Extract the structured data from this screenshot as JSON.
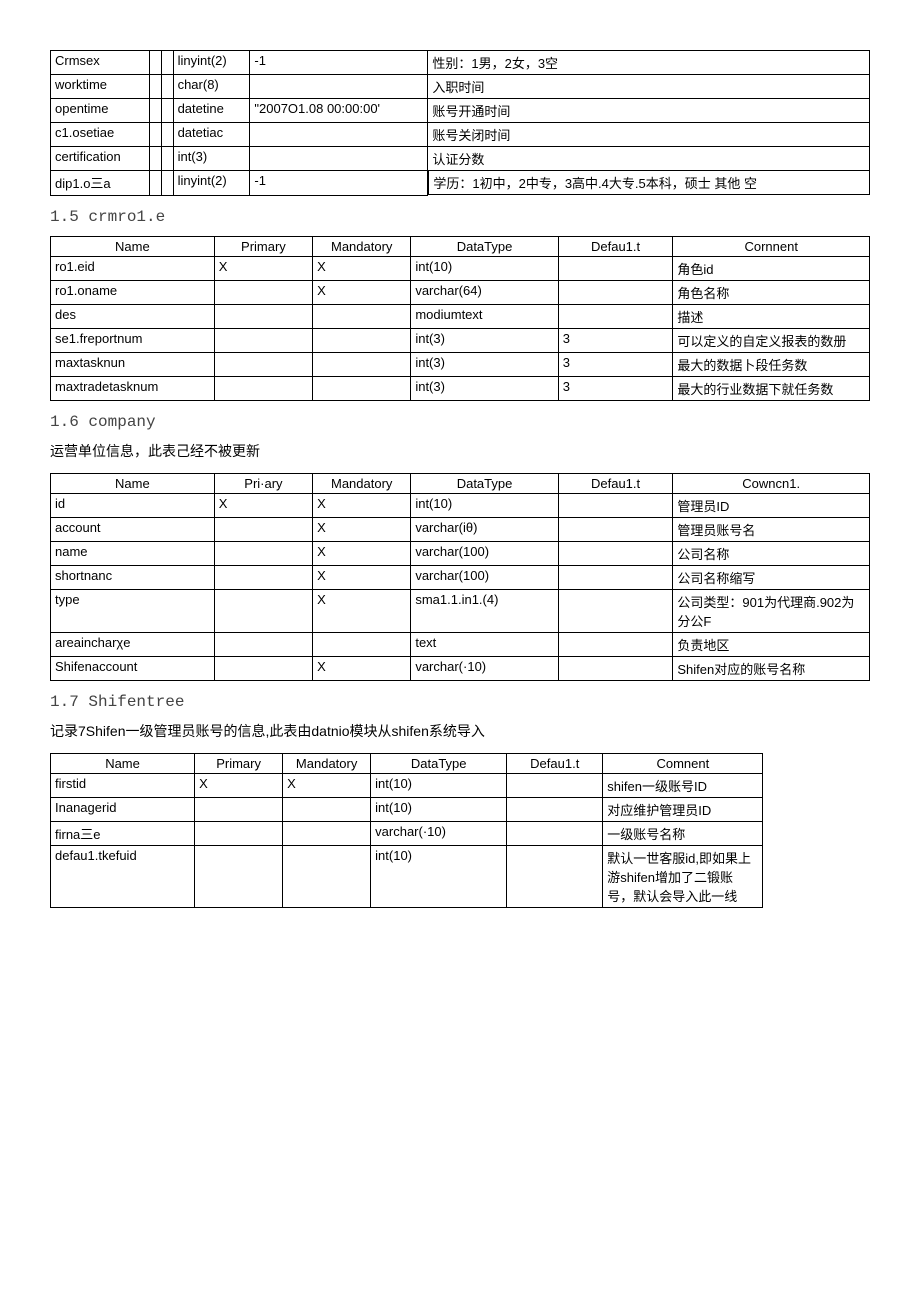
{
  "table1": {
    "rows": [
      {
        "name": "Crmsex",
        "primary": "",
        "mandatory": "",
        "datatype": "linyint(2)",
        "default": "-1",
        "comment": "性别：1男，2女，3空"
      },
      {
        "name": "worktime",
        "primary": "",
        "mandatory": "",
        "datatype": "char(8)",
        "default": "",
        "comment": "入职时间"
      },
      {
        "name": "opentime",
        "primary": "",
        "mandatory": "",
        "datatype": "datetine",
        "default": "\"2007O1.08 00:00:00'",
        "comment": "账号开通时间"
      },
      {
        "name": "c1.osetiae",
        "primary": "",
        "mandatory": "",
        "datatype": "datetiac",
        "default": "",
        "comment": "账号关闭时间"
      },
      {
        "name": "certification",
        "primary": "",
        "mandatory": "",
        "datatype": "int(3)",
        "default": "",
        "comment": "认证分数"
      },
      {
        "name": "dip1.o三a",
        "primary": "",
        "mandatory": "",
        "datatype": "linyint(2)",
        "default": "-1",
        "comment": "学历：1初中，2中专，3高中.4大专.5本科，硕士 其他 空"
      }
    ]
  },
  "section15": {
    "title": "1.5 crmro1.e",
    "headers": {
      "name": "Name",
      "primary": "Primary",
      "mandatory": "Mandatory",
      "datatype": "DataType",
      "default": "Defau1.t",
      "comment": "Cornnent"
    },
    "rows": [
      {
        "name": "ro1.eid",
        "primary": "X",
        "mandatory": "X",
        "datatype": "int(10)",
        "default": "",
        "comment": "角色id"
      },
      {
        "name": "ro1.oname",
        "primary": "",
        "mandatory": "X",
        "datatype": "varchar(64)",
        "default": "",
        "comment": "角色名称"
      },
      {
        "name": "des",
        "primary": "",
        "mandatory": "",
        "datatype": "modiumtext",
        "default": "",
        "comment": "描述"
      },
      {
        "name": "se1.freportnum",
        "primary": "",
        "mandatory": "",
        "datatype": "int(3)",
        "default": "3",
        "comment": "可以定义的自定义报表的数册"
      },
      {
        "name": "maxtasknun",
        "primary": "",
        "mandatory": "",
        "datatype": "int(3)",
        "default": "3",
        "comment": "最大的数据卜段任务数"
      },
      {
        "name": "maxtradetasknum",
        "primary": "",
        "mandatory": "",
        "datatype": "int(3)",
        "default": "3",
        "comment": "最大的行业数据下就任务数"
      }
    ]
  },
  "section16": {
    "title": "1.6 company",
    "desc": "运营单位信息，此表己经不被更新",
    "headers": {
      "name": "Name",
      "primary": "Pri·ary",
      "mandatory": "Mandatory",
      "datatype": "DataType",
      "default": "Defau1.t",
      "comment": "Cowncn1."
    },
    "rows": [
      {
        "name": "id",
        "primary": "X",
        "mandatory": "X",
        "datatype": "int(10)",
        "default": "",
        "comment": "管理员ID"
      },
      {
        "name": "account",
        "primary": "",
        "mandatory": "X",
        "datatype": "varchar(iθ)",
        "default": "",
        "comment": "管理员账号名"
      },
      {
        "name": "name",
        "primary": "",
        "mandatory": "X",
        "datatype": "varchar(100)",
        "default": "",
        "comment": "公司名称"
      },
      {
        "name": "shortnanc",
        "primary": "",
        "mandatory": "X",
        "datatype": "varchar(100)",
        "default": "",
        "comment": "公司名称缩写"
      },
      {
        "name": "type",
        "primary": "",
        "mandatory": "X",
        "datatype": "sma1.1.in1.(4)",
        "default": "",
        "comment": "公司类型：901为代理商.902为分公F"
      },
      {
        "name": "areaincharχe",
        "primary": "",
        "mandatory": "",
        "datatype": "text",
        "default": "",
        "comment": "负责地区"
      },
      {
        "name": "Shifenaccount",
        "primary": "",
        "mandatory": "X",
        "datatype": "varchar(·10)",
        "default": "",
        "comment": "Shifen对应的账号名称"
      }
    ]
  },
  "section17": {
    "title": "1.7 Shifentree",
    "desc": "记录7Shifen一级管理员账号的信息,此表由datnio模块从shifen系统导入",
    "headers": {
      "name": "Name",
      "primary": "Primary",
      "mandatory": "Mandatory",
      "datatype": "DataType",
      "default": "Defau1.t",
      "comment": "Comnent"
    },
    "rows": [
      {
        "name": "firstid",
        "primary": "X",
        "mandatory": "X",
        "datatype": "int(10)",
        "default": "",
        "comment": "shifen一级账号ID"
      },
      {
        "name": "Inanagerid",
        "primary": "",
        "mandatory": "",
        "datatype": "int(10)",
        "default": "",
        "comment": "对应维护管理员ID"
      },
      {
        "name": "firna三e",
        "primary": "",
        "mandatory": "",
        "datatype": "varchar(·10)",
        "default": "",
        "comment": "一级账号名称"
      },
      {
        "name": "defau1.tkefuid",
        "primary": "",
        "mandatory": "",
        "datatype": "int(10)",
        "default": "",
        "comment": "默认一世客服id,即如果上游shifen增加了二锻账号，默认会导入此一线"
      }
    ]
  }
}
